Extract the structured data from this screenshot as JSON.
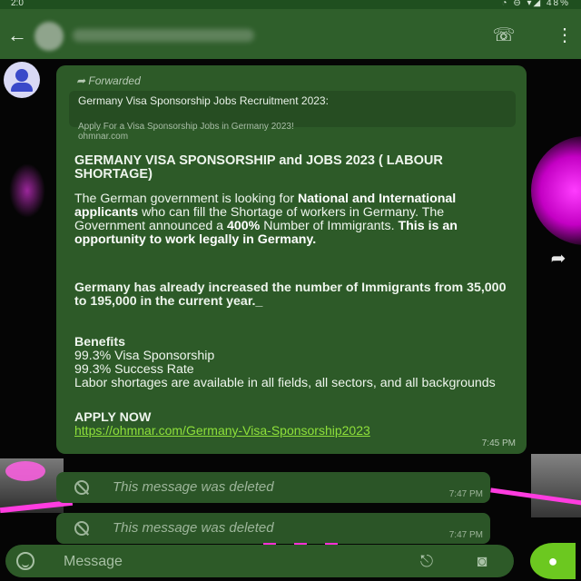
{
  "status_bar": {
    "time": "2:0",
    "icons": "◔ ⊖ ▾◢ 48%"
  },
  "app_bar": {
    "back_icon": "arrow-left-icon",
    "call_add_icon": "add-call-icon",
    "more_icon": "more-vert-icon"
  },
  "message": {
    "forwarded_label": "Forwarded",
    "preview_title": "Germany Visa Sponsorship Jobs Recruitment 2023:",
    "preview_desc": "Apply For a Visa Sponsorship Jobs in Germany 2023!",
    "preview_domain": "ohmnar.com",
    "heading": "GERMANY VISA SPONSORSHIP and JOBS 2023 ( LABOUR SHORTAGE)",
    "para1_a": "The German government is looking for ",
    "para1_b": "National and International applicants",
    "para1_c": " who can fill the Shortage of workers in Germany. The Government announced a ",
    "para1_d": "400%",
    "para1_e": " Number of Immigrants. ",
    "para1_f": "This is an opportunity to work legally in Germany.",
    "para2": "Germany has already increased the number of Immigrants from 35,000 to 195,000 in the current year._",
    "benefits_title": "Benefits",
    "benefit_1": "99.3% Visa Sponsorship",
    "benefit_2": "99.3% Success Rate",
    "benefit_3": "Labor shortages are available in all fields, all sectors, and all backgrounds",
    "apply_title": "APPLY NOW",
    "apply_link": "https://ohmnar.com/Germany-Visa-Sponsorship2023",
    "time": "7:45 PM"
  },
  "deleted_messages": [
    {
      "text": "This message was deleted",
      "time": "7:47 PM"
    },
    {
      "text": "This message was deleted",
      "time": "7:47 PM"
    }
  ],
  "input": {
    "placeholder": "Message"
  },
  "colors": {
    "bubble": "#2d5a28",
    "app_bar": "#2f5f2b",
    "link": "#8ee03a",
    "mic": "#6cc820"
  }
}
